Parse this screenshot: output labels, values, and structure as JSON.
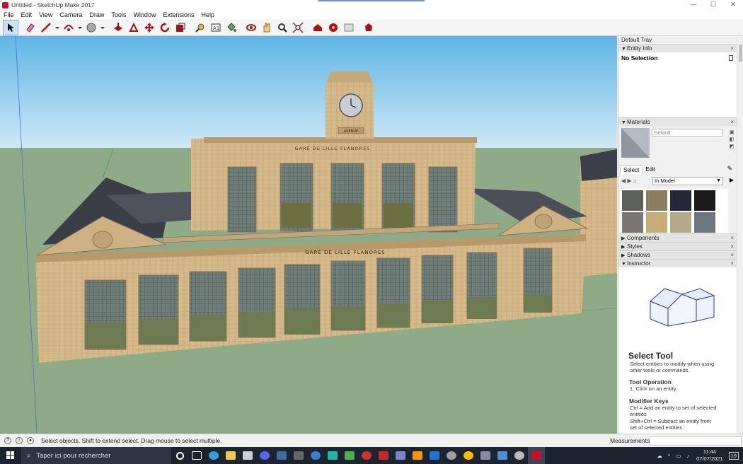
{
  "window": {
    "title": "Untitled - SketchUp Make 2017",
    "controls": [
      "—",
      "☐",
      "✕"
    ]
  },
  "menu": [
    "File",
    "Edit",
    "View",
    "Camera",
    "Draw",
    "Tools",
    "Window",
    "Extensions",
    "Help"
  ],
  "toolbar": {
    "tools": [
      "select-tool",
      "eraser-tool",
      "line-tool",
      "line-dropdown",
      "arc-tool",
      "arc-dropdown",
      "shape-tool",
      "shape-dropdown",
      "push-pull-tool",
      "offset-tool",
      "move-tool",
      "rotate-tool",
      "scale-tool",
      "tape-measure-tool",
      "text-tool",
      "paint-bucket-tool",
      "orbit-tool",
      "pan-tool",
      "zoom-tool",
      "zoom-extents-tool",
      "warehouse-tool",
      "extension-warehouse-tool",
      "layout-tool",
      "extension-manager-tool"
    ],
    "active": "select-tool"
  },
  "viewport": {
    "sign_upper": "GARE DE LILLE FLANDRES",
    "sign_lower": "GARE DE LILLE FLANDRES",
    "clock_plate": "AVENUE"
  },
  "tray": {
    "title": "Default Tray",
    "entity_info": {
      "header": "Entity Info",
      "status": "No Selection"
    },
    "materials": {
      "header": "Materials",
      "material_name": "Default",
      "tabs": [
        "Select",
        "Edit"
      ],
      "collection": "In Model",
      "swatch_colors": [
        "#5d5f5c",
        "#8c7d5f",
        "#25273a",
        "#1b1b1d",
        "#7a7775",
        "#c9ad78",
        "#b5a98c",
        "#6e7680"
      ]
    },
    "collapsed_panels": [
      "Components",
      "Styles",
      "Shadows"
    ],
    "instructor": {
      "header": "Instructor",
      "title": "Select Tool",
      "description": "Select entities to modify when using other tools or commands.",
      "op_title": "Tool Operation",
      "op_step": "1. Click on an entity.",
      "mod_title": "Modifier Keys",
      "mod_1": "Ctrl = Add an entity to set of selected entities",
      "mod_2": "Shift+Ctrl = Subtract an entity from set of selected entities"
    }
  },
  "statusbar": {
    "message": "Select objects. Shift to extend select. Drag mouse to select multiple.",
    "measurements_label": "Measurements"
  },
  "taskbar": {
    "search_placeholder": "Taper ici pour rechercher",
    "time": "11:44",
    "date": "07/07/2021",
    "notifications": "19"
  }
}
